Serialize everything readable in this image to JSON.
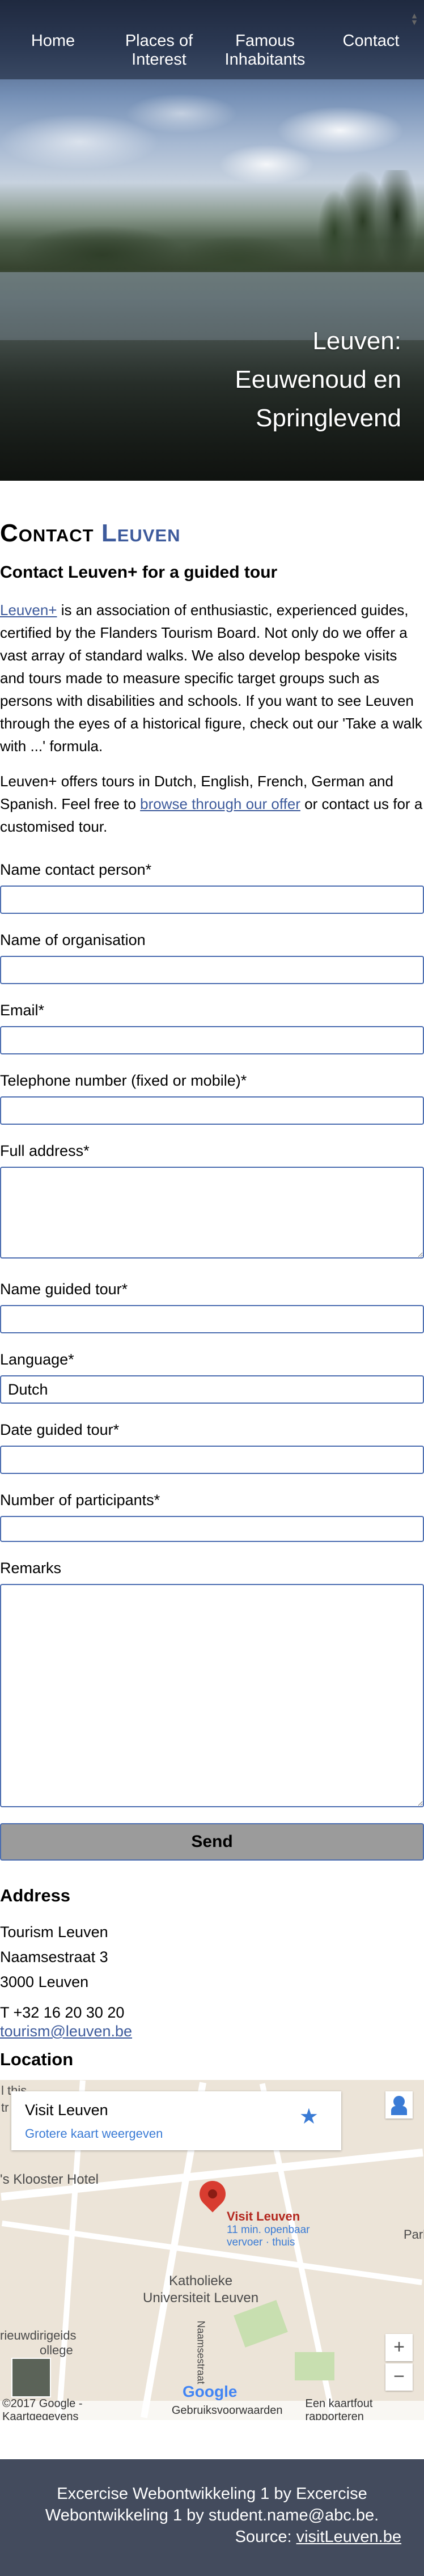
{
  "nav": {
    "items": [
      "Home",
      "Places of Interest",
      "Famous Inhabitants",
      "Contact"
    ]
  },
  "hero": {
    "title": "Leuven: Eeuwenoud en Springlevend"
  },
  "page": {
    "title_part1": "Contact",
    "title_part2": "Leuven",
    "subtitle": "Contact Leuven+ for a guided tour",
    "intro_link": "Leuven+",
    "intro_text": " is an association of enthusiastic, experienced guides, certified by the Flanders Tourism Board. Not only do we offer a vast array of standard walks. We also develop bespoke visits and tours made to measure specific target groups such as persons with disabilities and schools. If you want to see Leuven through the eyes of a historical figure, check out our 'Take a walk with ...' formula.",
    "p2_before": "Leuven+ offers tours in Dutch, English, French, German and Spanish. Feel free to ",
    "p2_link": "browse through our offer",
    "p2_after": " or contact us for a customised tour."
  },
  "form": {
    "contact_person_label": "Name contact person*",
    "organisation_label": "Name of organisation",
    "email_label": "Email*",
    "telephone_label": "Telephone number (fixed or mobile)*",
    "address_label": "Full address*",
    "guided_tour_label": "Name guided tour*",
    "language_label": "Language*",
    "language_value": "Dutch",
    "date_label": "Date guided tour*",
    "participants_label": "Number of participants*",
    "remarks_label": "Remarks",
    "send_label": "Send"
  },
  "address": {
    "heading": "Address",
    "org": "Tourism Leuven",
    "street": "Naamsestraat 3",
    "city": "3000 Leuven",
    "phone": "T +32 16 20 30 20",
    "email": "tourism@leuven.be"
  },
  "location": {
    "heading": "Location",
    "card_title": "Visit Leuven",
    "card_link": "Grotere kaart weergeven",
    "label_this": "l this",
    "label_tr": "tr",
    "label_hotel": "'s Klooster Hotel",
    "label_poi": "Visit Leuven",
    "label_transit": "11 min. openbaar vervoer · thuis",
    "label_uni1": "Katholieke",
    "label_uni2": "Universiteit Leuven",
    "label_college1": "rieuwdirigeids",
    "label_college2": "ollege",
    "label_street": "Naamsestraat",
    "label_park": "Park",
    "zoom_in": "+",
    "zoom_out": "−",
    "google": "Google",
    "attribution": "©2017 Google - Kaartgegevens",
    "terms": "Gebruiksvoorwaarden",
    "report": "Een kaartfout rapporteren"
  },
  "footer": {
    "line1": "Excercise Webontwikkeling 1 by Excercise Webontwikkeling 1 by student.name@abc.be.",
    "source_label": "Source: ",
    "source_link": "visitLeuven.be"
  }
}
